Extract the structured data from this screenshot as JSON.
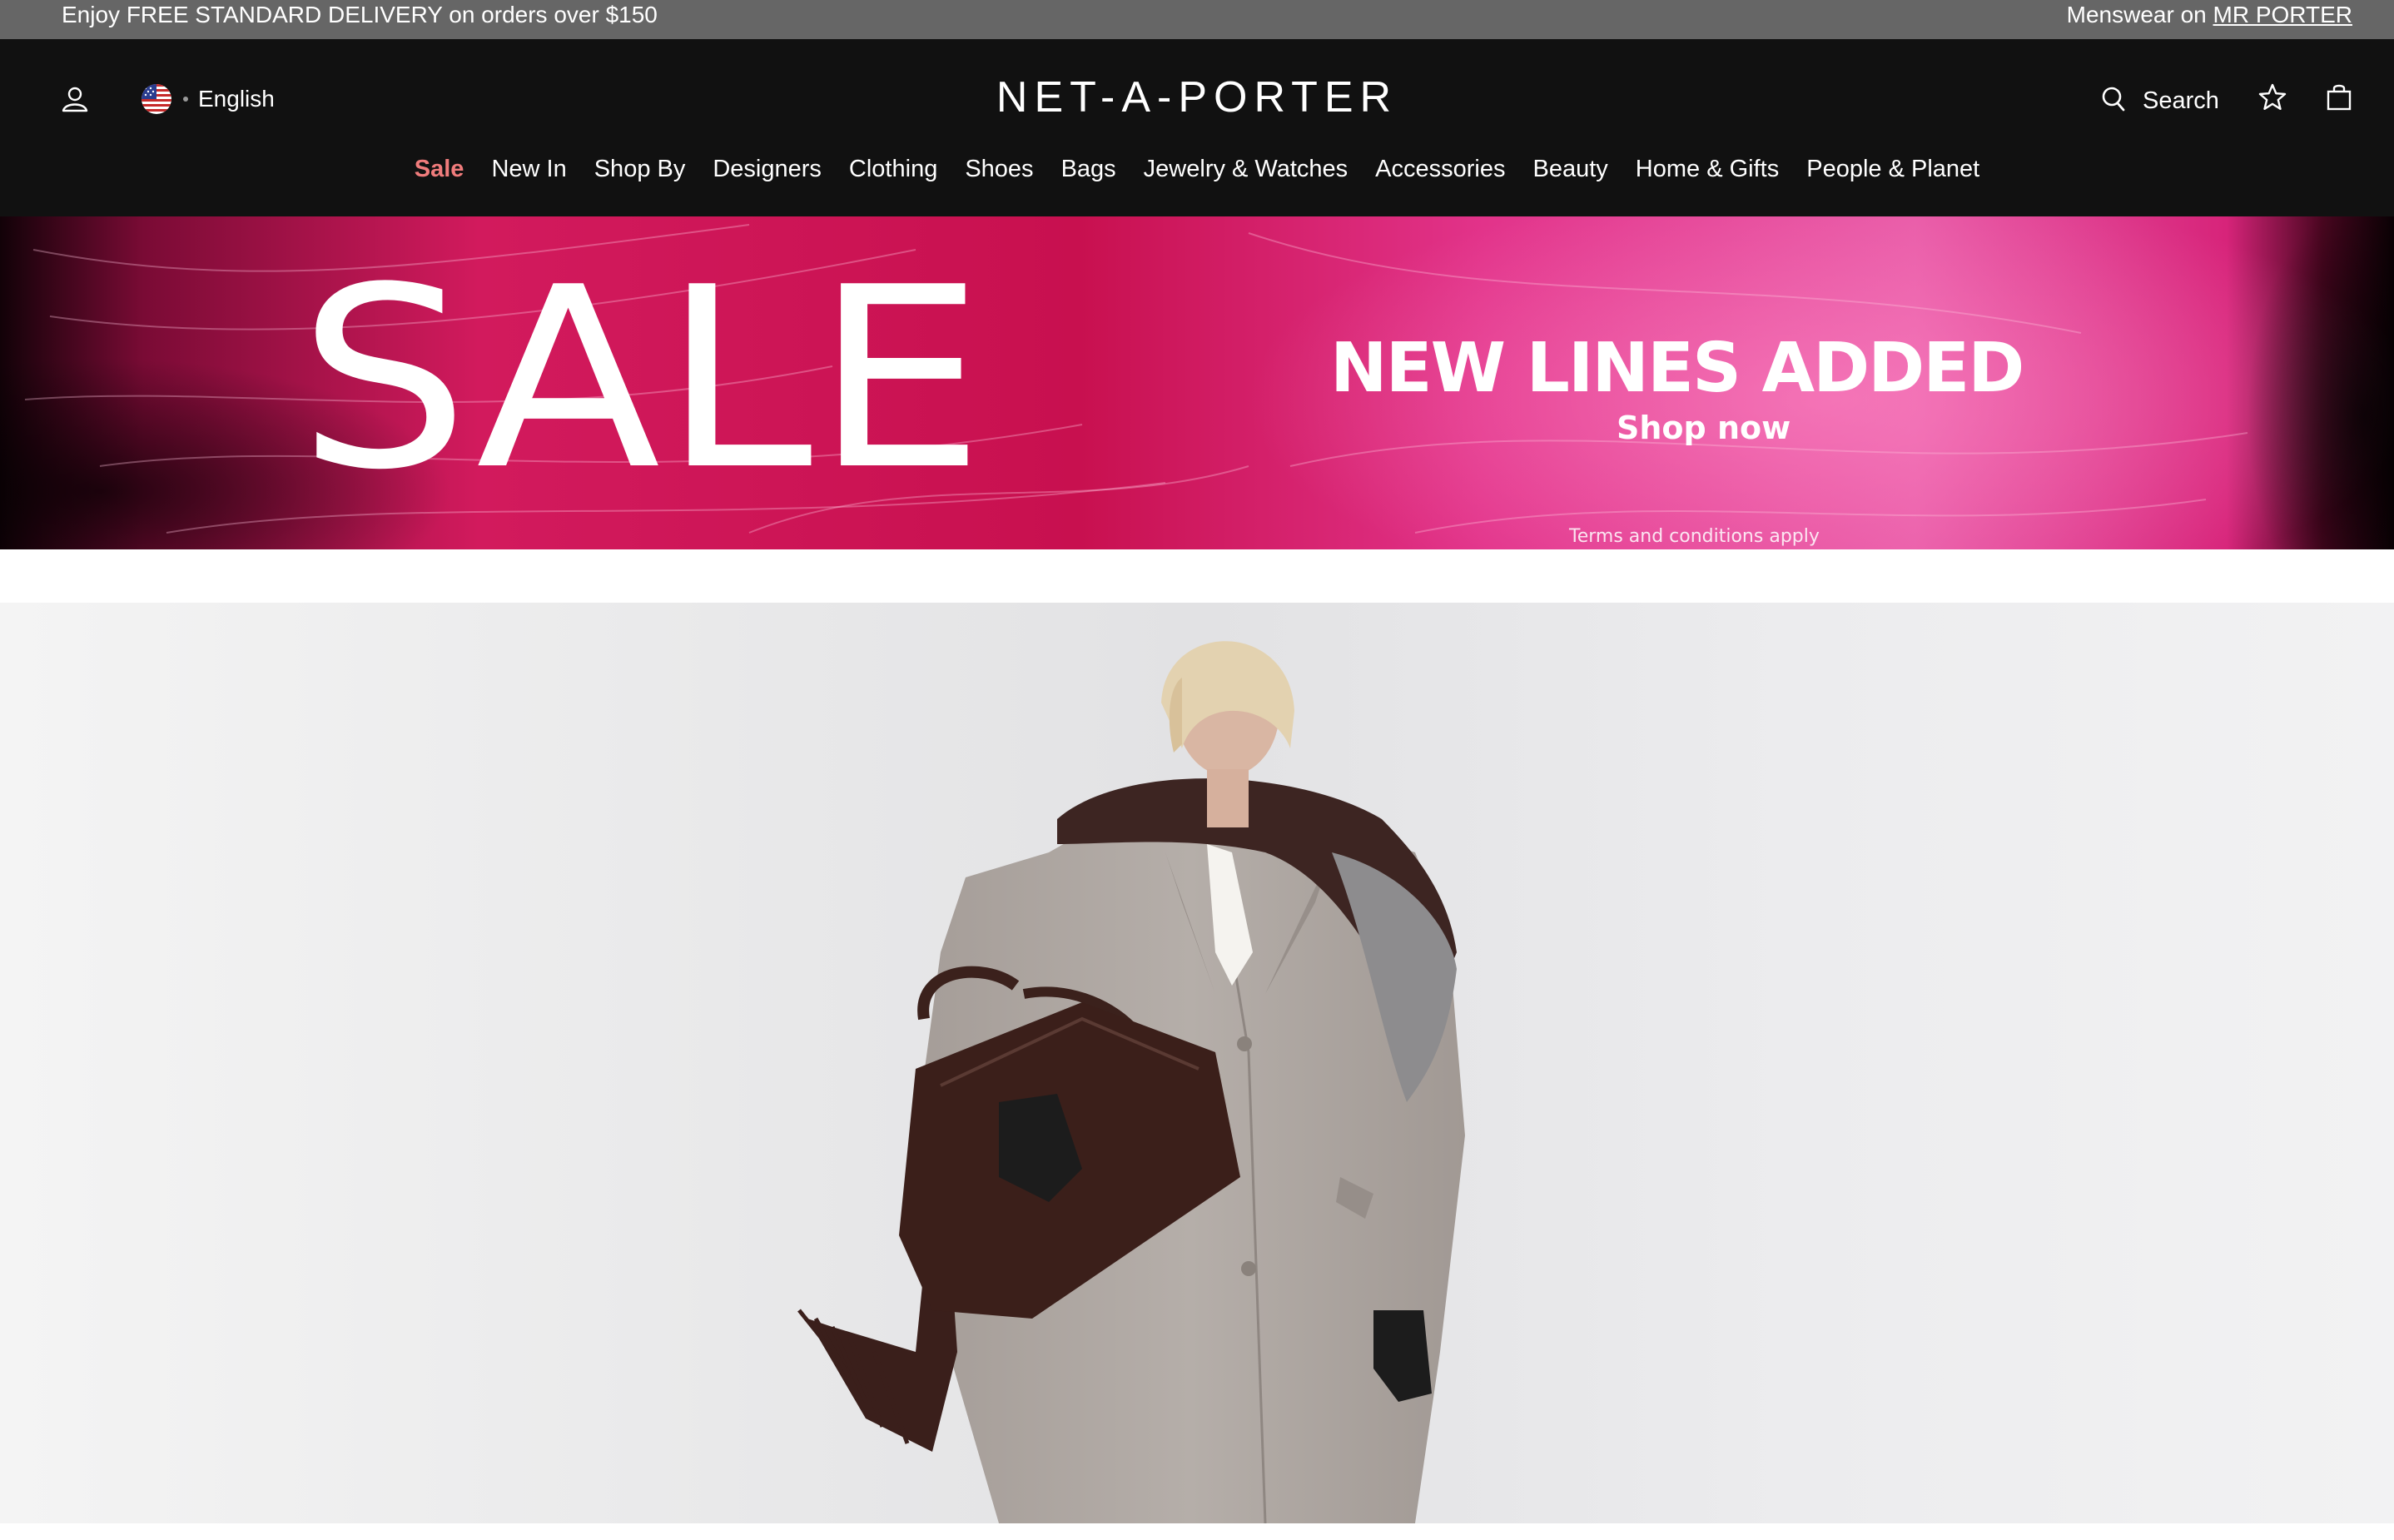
{
  "promo": {
    "left_text": "Enjoy FREE STANDARD DELIVERY on orders over $150",
    "right_prefix": "Menswear on",
    "right_link": "MR PORTER"
  },
  "header": {
    "logo": "NET-A-PORTER",
    "language": "English",
    "search_label": "Search",
    "icons": {
      "account": "user-icon",
      "flag": "us-flag-icon",
      "search": "search-icon",
      "wishlist": "star-icon",
      "bag": "shopping-bag-icon"
    }
  },
  "nav": {
    "items": [
      "Sale",
      "New In",
      "Shop By",
      "Designers",
      "Clothing",
      "Shoes",
      "Bags",
      "Jewelry & Watches",
      "Accessories",
      "Beauty",
      "Home & Gifts",
      "People & Planet"
    ],
    "sale_color": "#f07c7c"
  },
  "banner": {
    "sale_word": "SALE",
    "headline": "NEW LINES ADDED",
    "cta": "Shop now",
    "terms": "Terms and conditions apply",
    "accent": "#e0105e"
  },
  "colors": {
    "promo_bg": "#666666",
    "header_bg": "#111111"
  }
}
